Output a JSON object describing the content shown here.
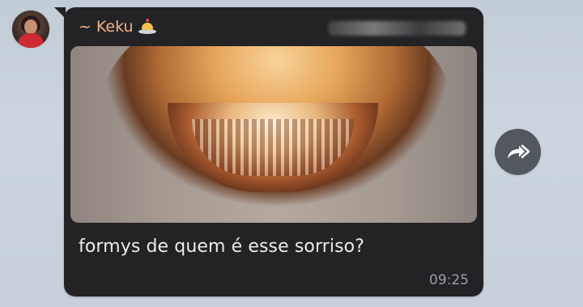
{
  "sender": {
    "prefix": "~",
    "name": "Keku",
    "emoji_icon": "cake-icon"
  },
  "message": {
    "text": "formys de quem é esse sorriso?",
    "time": "09:25"
  },
  "forward": {
    "icon": "forward-icon"
  },
  "colors": {
    "bubble": "#232326",
    "sender_name": "#f0b28a",
    "forward_button": "#53585f",
    "background": "#c7d0da"
  }
}
